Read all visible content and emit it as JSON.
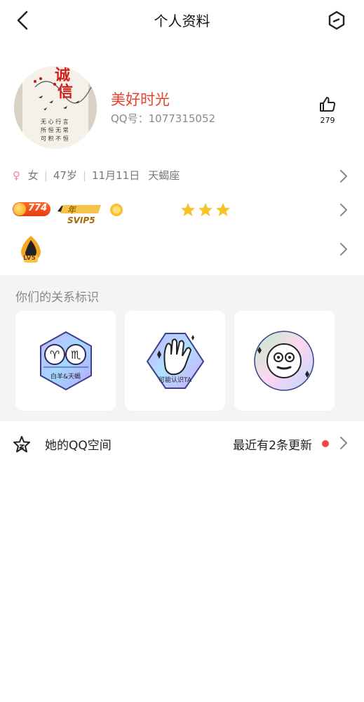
{
  "header": {
    "title": "个人资料",
    "back_icon": "chevron-left-icon",
    "settings_icon": "hexagon-settings-icon"
  },
  "profile": {
    "nickname": "美好时光",
    "qq_label": "QQ号：1077315052",
    "likes": "279",
    "avatar_text": "诚信",
    "colors": {
      "nickname": "#e8412f"
    }
  },
  "info": {
    "gender_icon": "female-icon",
    "gender": "女",
    "age": "47岁",
    "birthday": "11月11日",
    "zodiac": "天蝎座"
  },
  "badges": {
    "level": "774",
    "svip": "年SVIP5",
    "crown_icons": [
      "sun-icon",
      "moon-icon",
      "moon-icon",
      "moon-icon",
      "star-icon",
      "star-icon",
      "star-icon"
    ]
  },
  "honor": {
    "level_label": "LV5"
  },
  "relations": {
    "title": "你们的关系标识",
    "cards": [
      {
        "label": "白羊&天蝎",
        "icon": "aries-scorpio-icon"
      },
      {
        "label": "可能认识TA",
        "icon": "waving-hand-icon"
      },
      {
        "label": "",
        "icon": "smiley-face-icon"
      }
    ]
  },
  "qzone": {
    "label": "她的QQ空间",
    "update_text": "最近有2条更新",
    "icon": "star-outline-icon"
  }
}
